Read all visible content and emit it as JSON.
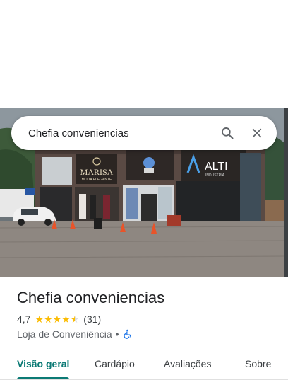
{
  "search": {
    "query": "Chefia conveniencias"
  },
  "photo": {
    "sign_marisa": "MARISA",
    "sign_marisa_sub": "MODA ELEGANTE",
    "sign_alti": "ALTI",
    "sign_alti_sub": "INDÚSTRIA"
  },
  "place": {
    "title": "Chefia conveniencias",
    "rating": "4,7",
    "stars": 4.7,
    "reviews": "(31)",
    "category": "Loja de Conveniência",
    "separator": "•"
  },
  "tabs": [
    {
      "label": "Visão geral",
      "active": true
    },
    {
      "label": "Cardápio",
      "active": false
    },
    {
      "label": "Avaliações",
      "active": false
    },
    {
      "label": "Sobre",
      "active": false
    }
  ],
  "colors": {
    "accent": "#0b7a75",
    "star": "#fbbc04"
  },
  "icons": {
    "search": "search-icon",
    "close": "close-icon",
    "accessibility": "wheelchair-icon"
  }
}
